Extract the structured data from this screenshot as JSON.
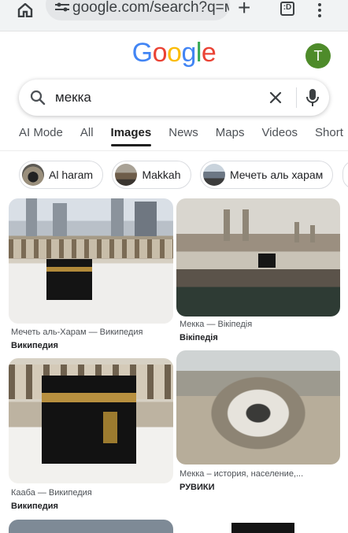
{
  "browser": {
    "url": "google.com/search?q=мекк",
    "tabs_count": ":D"
  },
  "header": {
    "logo_letters": [
      "G",
      "o",
      "o",
      "g",
      "l",
      "e"
    ],
    "logo_colors": [
      "#4285F4",
      "#EA4335",
      "#FBBC05",
      "#4285F4",
      "#34A853",
      "#EA4335"
    ],
    "avatar_letter": "T",
    "avatar_color": "#4e8b2a"
  },
  "search": {
    "query": "мекка"
  },
  "tabs": [
    "AI Mode",
    "All",
    "Images",
    "News",
    "Maps",
    "Videos",
    "Short"
  ],
  "active_tab": "Images",
  "chips": [
    {
      "label": "Al haram"
    },
    {
      "label": "Makkah"
    },
    {
      "label": "Мечеть аль харам"
    }
  ],
  "results": [
    {
      "caption": "Мечеть аль-Харам — Википедия",
      "source": "Википедия"
    },
    {
      "caption": "Мекка — Вікіпедія",
      "source": "Вікіпедія"
    },
    {
      "caption": "Кааба — Википедия",
      "source": "Википедия"
    },
    {
      "caption": "Мекка – история, население,...",
      "source": "РУВИКИ"
    }
  ]
}
